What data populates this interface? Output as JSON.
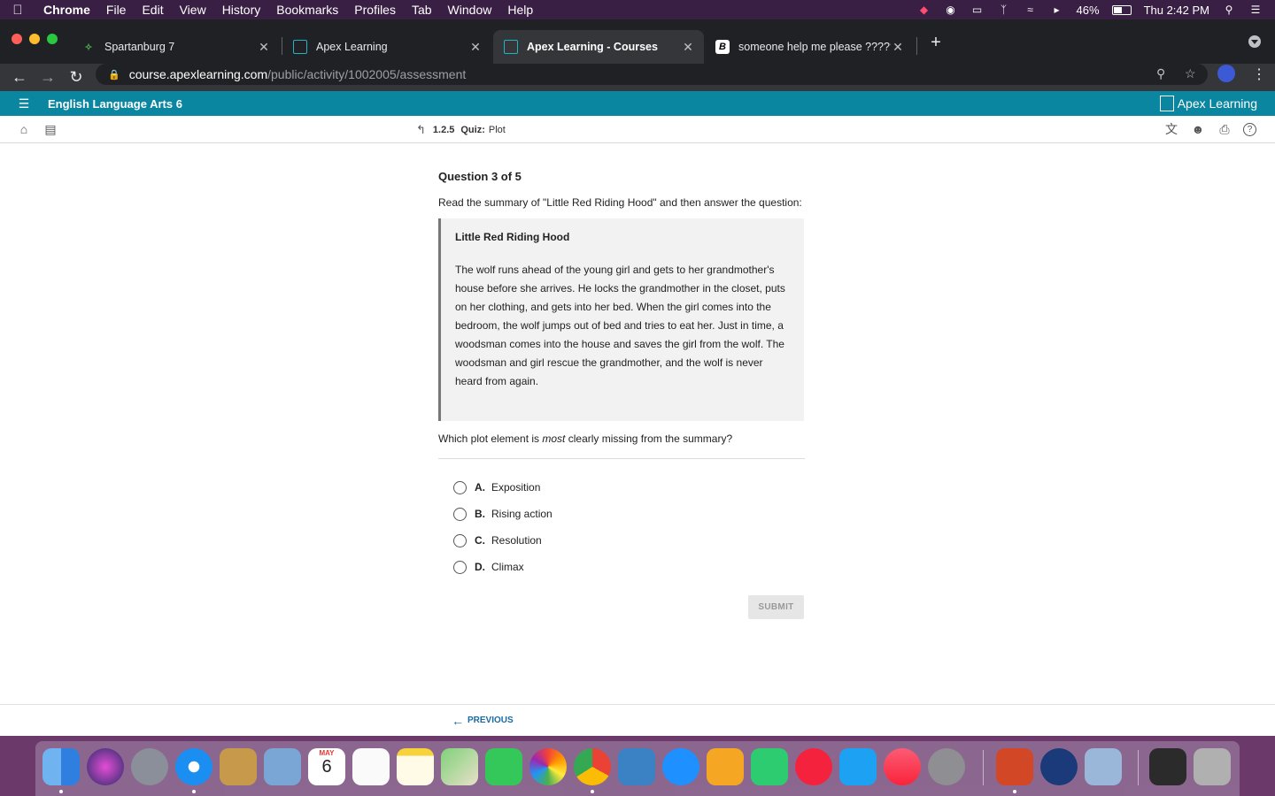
{
  "menubar": {
    "app": "Chrome",
    "items": [
      "File",
      "Edit",
      "View",
      "History",
      "Bookmarks",
      "Profiles",
      "Tab",
      "Window",
      "Help"
    ],
    "battery": "46%",
    "clock": "Thu 2:42 PM"
  },
  "tabs": [
    {
      "title": "Spartanburg 7",
      "favicon": "spartanburg-favicon"
    },
    {
      "title": "Apex Learning",
      "favicon": "apex-favicon"
    },
    {
      "title": "Apex Learning - Courses",
      "favicon": "apex-favicon",
      "active": true
    },
    {
      "title": "someone help me please ?????",
      "favicon": "brainly-favicon"
    }
  ],
  "address": {
    "host": "course.apexlearning.com",
    "path": "/public/activity/1002005/assessment"
  },
  "apex": {
    "course_title": "English Language Arts 6",
    "brand": "Apex Learning",
    "activity_number": "1.2.5",
    "activity_type": "Quiz:",
    "activity_name": "Plot"
  },
  "question": {
    "heading": "Question 3 of 5",
    "intro": "Read the summary of \"Little Red Riding Hood\" and then answer the question:",
    "passage_title": "Little Red Riding Hood",
    "passage_body": "The wolf runs ahead of the young girl and gets to her grandmother's house before she arrives. He locks the grandmother in the closet, puts on her clothing, and gets into her bed. When the girl comes into the bedroom, the wolf jumps out of bed and tries to eat her. Just in time, a woodsman comes into the house and saves the girl from the wolf. The woodsman and girl rescue the grandmother, and the wolf is never heard from again.",
    "prompt_before": "Which plot element is ",
    "prompt_emphasis": "most",
    "prompt_after": " clearly missing from the summary?",
    "options": [
      {
        "letter": "A.",
        "text": "Exposition"
      },
      {
        "letter": "B.",
        "text": "Rising action"
      },
      {
        "letter": "C.",
        "text": "Resolution"
      },
      {
        "letter": "D.",
        "text": "Climax"
      }
    ],
    "submit_label": "SUBMIT"
  },
  "footer": {
    "previous_label": "PREVIOUS"
  },
  "dock": {
    "calendar_month": "MAY",
    "calendar_day": "6"
  }
}
